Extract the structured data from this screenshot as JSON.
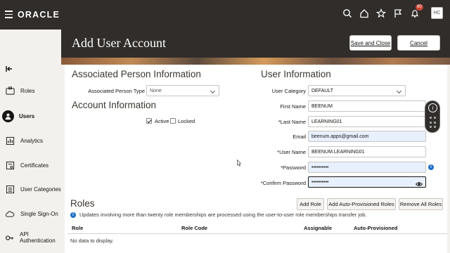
{
  "topbar": {
    "logo": "ORACLE",
    "notifications_count": "90",
    "avatar_initials": "HC",
    "icons": [
      "search-icon",
      "home-icon",
      "star-icon",
      "flag-icon",
      "bell-icon"
    ]
  },
  "header": {
    "title": "Add User Account",
    "save_close_label": "Save and Close",
    "cancel_label": "Cancel"
  },
  "sidebar": {
    "items": [
      {
        "label": "Roles",
        "icon": "roles-icon"
      },
      {
        "label": "Users",
        "icon": "user-icon"
      },
      {
        "label": "Analytics",
        "icon": "analytics-icon"
      },
      {
        "label": "Certificates",
        "icon": "certificate-icon"
      },
      {
        "label": "User Categories",
        "icon": "categories-icon"
      },
      {
        "label": "Single Sign-On",
        "icon": "cloud-icon"
      },
      {
        "label": "API Authentication",
        "icon": "key-icon"
      }
    ],
    "active": "Users"
  },
  "associated": {
    "title": "Associated Person Information",
    "type_label": "Associated Person Type",
    "type_value": "None"
  },
  "account": {
    "title": "Account Information",
    "active_label": "Active",
    "active_checked": true,
    "locked_label": "Locked",
    "locked_checked": false
  },
  "user_info": {
    "title": "User Information",
    "category_label": "User Category",
    "category_value": "DEFAULT",
    "first_name_label": "First Name",
    "first_name_value": "BEENUM",
    "last_name_label": "*Last Name",
    "last_name_value": "LEARNING01",
    "email_label": "Email",
    "email_value": "beenum.apps@gmail.com",
    "username_label": "*User Name",
    "username_value": "BEENUM.LEARNING01",
    "password_label": "*Password",
    "password_value": "••••••••••",
    "confirm_label": "*Confirm Password",
    "confirm_value": "••••••••••"
  },
  "roles": {
    "title": "Roles",
    "add_role_label": "Add Role",
    "add_auto_label": "Add Auto-Provisioned Roles",
    "remove_all_label": "Remove All Roles",
    "note": "Updates involving more than twenty role memberships are processed using the user-to-user role memberships transfer job.",
    "columns": [
      "Role",
      "Role Code",
      "Assignable",
      "Auto-Provisioned"
    ],
    "empty_text": "No data to display."
  }
}
